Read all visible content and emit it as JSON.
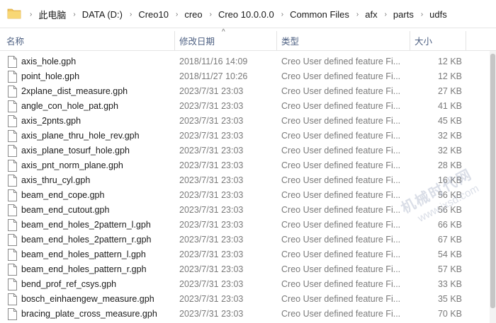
{
  "breadcrumb": [
    "此电脑",
    "DATA (D:)",
    "Creo10",
    "creo",
    "Creo 10.0.0.0",
    "Common Files",
    "afx",
    "parts",
    "udfs"
  ],
  "columns": {
    "name": "名称",
    "date": "修改日期",
    "type": "类型",
    "size": "大小"
  },
  "files": [
    {
      "name": "axis_hole.gph",
      "date": "2018/11/16 14:09",
      "type": "Creo User defined feature Fi...",
      "size": "12 KB"
    },
    {
      "name": "point_hole.gph",
      "date": "2018/11/27 10:26",
      "type": "Creo User defined feature Fi...",
      "size": "12 KB"
    },
    {
      "name": "2xplane_dist_measure.gph",
      "date": "2023/7/31 23:03",
      "type": "Creo User defined feature Fi...",
      "size": "27 KB"
    },
    {
      "name": "angle_con_hole_pat.gph",
      "date": "2023/7/31 23:03",
      "type": "Creo User defined feature Fi...",
      "size": "41 KB"
    },
    {
      "name": "axis_2pnts.gph",
      "date": "2023/7/31 23:03",
      "type": "Creo User defined feature Fi...",
      "size": "45 KB"
    },
    {
      "name": "axis_plane_thru_hole_rev.gph",
      "date": "2023/7/31 23:03",
      "type": "Creo User defined feature Fi...",
      "size": "32 KB"
    },
    {
      "name": "axis_plane_tosurf_hole.gph",
      "date": "2023/7/31 23:03",
      "type": "Creo User defined feature Fi...",
      "size": "32 KB"
    },
    {
      "name": "axis_pnt_norm_plane.gph",
      "date": "2023/7/31 23:03",
      "type": "Creo User defined feature Fi...",
      "size": "28 KB"
    },
    {
      "name": "axis_thru_cyl.gph",
      "date": "2023/7/31 23:03",
      "type": "Creo User defined feature Fi...",
      "size": "16 KB"
    },
    {
      "name": "beam_end_cope.gph",
      "date": "2023/7/31 23:03",
      "type": "Creo User defined feature Fi...",
      "size": "56 KB"
    },
    {
      "name": "beam_end_cutout.gph",
      "date": "2023/7/31 23:03",
      "type": "Creo User defined feature Fi...",
      "size": "56 KB"
    },
    {
      "name": "beam_end_holes_2pattern_l.gph",
      "date": "2023/7/31 23:03",
      "type": "Creo User defined feature Fi...",
      "size": "66 KB"
    },
    {
      "name": "beam_end_holes_2pattern_r.gph",
      "date": "2023/7/31 23:03",
      "type": "Creo User defined feature Fi...",
      "size": "67 KB"
    },
    {
      "name": "beam_end_holes_pattern_l.gph",
      "date": "2023/7/31 23:03",
      "type": "Creo User defined feature Fi...",
      "size": "54 KB"
    },
    {
      "name": "beam_end_holes_pattern_r.gph",
      "date": "2023/7/31 23:03",
      "type": "Creo User defined feature Fi...",
      "size": "57 KB"
    },
    {
      "name": "bend_prof_ref_csys.gph",
      "date": "2023/7/31 23:03",
      "type": "Creo User defined feature Fi...",
      "size": "33 KB"
    },
    {
      "name": "bosch_einhaengew_measure.gph",
      "date": "2023/7/31 23:03",
      "type": "Creo User defined feature Fi...",
      "size": "35 KB"
    },
    {
      "name": "bracing_plate_cross_measure.gph",
      "date": "2023/7/31 23:03",
      "type": "Creo User defined feature Fi...",
      "size": "70 KB"
    }
  ],
  "watermark": {
    "cn": "机械时代网",
    "url": "www.jxsd.com"
  },
  "icons": {
    "folder": "folder-icon",
    "file": "file-icon",
    "sort": "sort-up-icon"
  },
  "colors": {
    "header_text": "#4d6082",
    "folder": "#f2c55c",
    "secondary_text": "#7a7a7a"
  }
}
